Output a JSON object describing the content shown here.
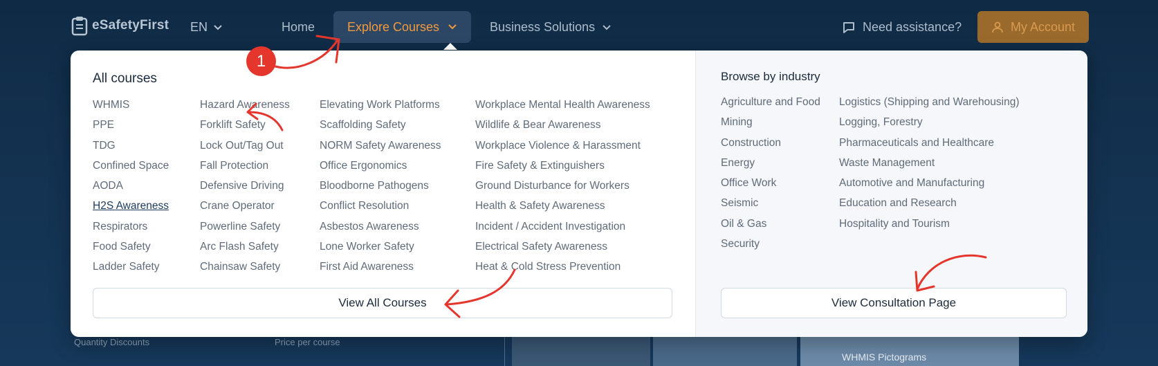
{
  "background": {
    "left_label_1": "Quantity Discounts",
    "left_label_2": "Price per course",
    "panel_label": "WHMIS Pictograms"
  },
  "nav": {
    "logo_text": "eSafetyFirst",
    "language": "EN",
    "home": "Home",
    "explore": "Explore Courses",
    "business": "Business Solutions",
    "help": "Need assistance?",
    "account": "My Account"
  },
  "dropdown": {
    "all_courses_title": "All courses",
    "columns": [
      [
        "WHMIS",
        "PPE",
        "TDG",
        "Confined Space",
        "AODA",
        "H2S Awareness",
        "Respirators",
        "Food Safety",
        "Ladder Safety"
      ],
      [
        "Hazard Awareness",
        "Forklift Safety",
        "Lock Out/Tag Out",
        "Fall Protection",
        "Defensive Driving",
        "Crane Operator",
        "Powerline Safety",
        "Arc Flash Safety",
        "Chainsaw Safety"
      ],
      [
        "Elevating Work Platforms",
        "Scaffolding Safety",
        "NORM Safety Awareness",
        "Office Ergonomics",
        "Bloodborne Pathogens",
        "Conflict Resolution",
        "Asbestos Awareness",
        "Lone Worker Safety",
        "First Aid Awareness"
      ],
      [
        "Workplace Mental Health Awareness",
        "Wildlife & Bear Awareness",
        "Workplace Violence & Harassment",
        "Fire Safety & Extinguishers",
        "Ground Disturbance for Workers",
        "Health & Safety Awareness",
        "Incident / Accident Investigation",
        "Electrical Safety Awareness",
        "Heat & Cold Stress Prevention"
      ]
    ],
    "view_all_label": "View All Courses",
    "industry_title": "Browse by industry",
    "industries": [
      [
        "Agriculture and Food",
        "Mining",
        "Construction",
        "Energy",
        "Office Work",
        "Seismic",
        "Oil & Gas",
        "Security"
      ],
      [
        "Logistics (Shipping and Warehousing)",
        "Logging, Forestry",
        "Pharmaceuticals and Healthcare",
        "Waste Management",
        "Automotive and Manufacturing",
        "Education and Research",
        "Hospitality and Tourism"
      ]
    ],
    "consult_label": "View Consultation Page"
  },
  "annotation": {
    "badge_number": "1",
    "color": "#e4362d"
  }
}
